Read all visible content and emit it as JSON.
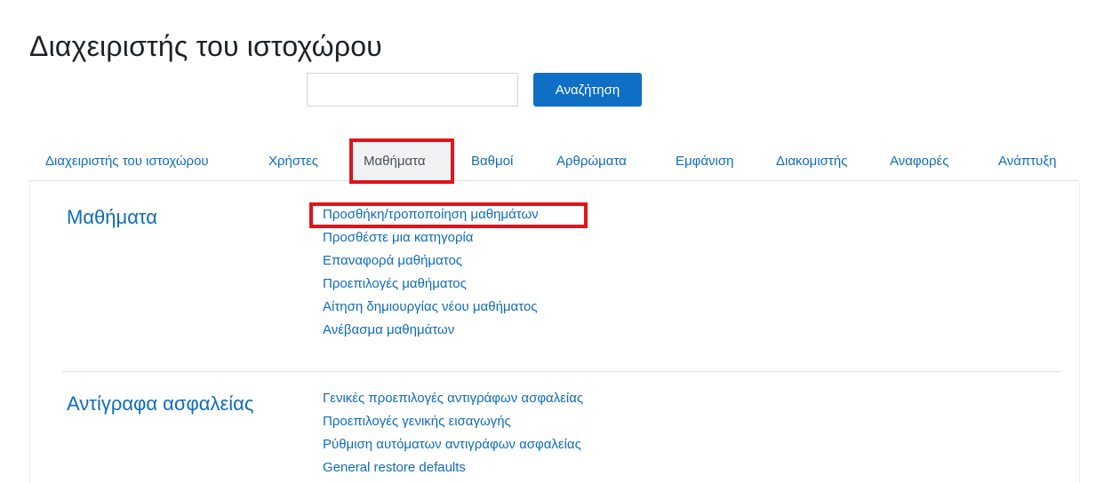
{
  "header": {
    "title": "Διαχειριστής του ιστοχώρου"
  },
  "search": {
    "value": "",
    "placeholder": "",
    "button_label": "Αναζήτηση"
  },
  "tabs": [
    {
      "label": "Διαχειριστής του ιστοχώρου",
      "active": false
    },
    {
      "label": "Χρήστες",
      "active": false
    },
    {
      "label": "Μαθήματα",
      "active": true
    },
    {
      "label": "Βαθμοί",
      "active": false
    },
    {
      "label": "Αρθρώματα",
      "active": false
    },
    {
      "label": "Εμφάνιση",
      "active": false
    },
    {
      "label": "Διακομιστής",
      "active": false
    },
    {
      "label": "Αναφορές",
      "active": false
    },
    {
      "label": "Ανάπτυξη",
      "active": false
    }
  ],
  "sections": [
    {
      "heading": "Μαθήματα",
      "links": [
        "Προσθήκη/τροποποίηση μαθημάτων",
        "Προσθέστε μια κατηγορία",
        "Επαναφορά μαθήματος",
        "Προεπιλογές μαθήματος",
        "Αίτηση δημιουργίας νέου μαθήματος",
        "Ανέβασμα μαθημάτων"
      ]
    },
    {
      "heading": "Αντίγραφα ασφαλείας",
      "links": [
        "Γενικές προεπιλογές αντιγράφων ασφαλείας",
        "Προεπιλογές γενικής εισαγωγής",
        "Ρύθμιση αυτόματων αντιγράφων ασφαλείας",
        "General restore defaults"
      ]
    }
  ],
  "colors": {
    "link": "#0f6cbf",
    "button": "#0f6fc5",
    "highlight": "#e0141b"
  }
}
